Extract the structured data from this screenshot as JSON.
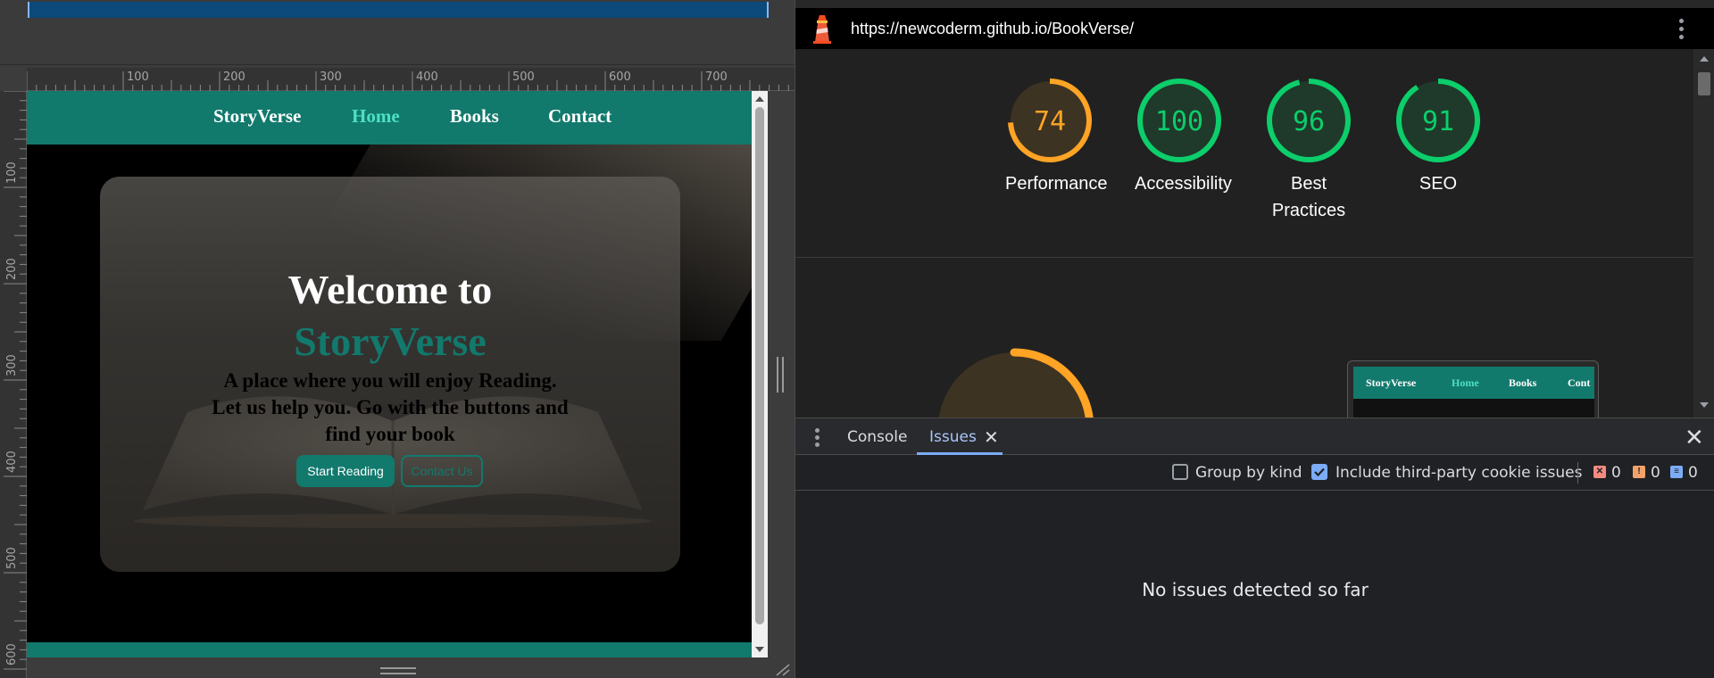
{
  "viewport_rulers": {
    "h_labels": [
      "100",
      "200",
      "300",
      "400",
      "500",
      "600",
      "700"
    ],
    "v_labels": [
      "100",
      "200",
      "300",
      "400",
      "500",
      "600"
    ]
  },
  "site": {
    "nav": {
      "brand": "StoryVerse",
      "links": [
        "Home",
        "Books",
        "Contact"
      ],
      "active_link": "Home"
    },
    "hero": {
      "title": "Welcome to",
      "brand": "StoryVerse",
      "subtitle": "A place where you will enjoy Reading. Let us help you. Go with the buttons and find your book",
      "primary_button": "Start Reading",
      "secondary_button": "Contact Us"
    },
    "colors": {
      "teal": "#12796d",
      "active_link": "#4de0c4"
    }
  },
  "devtools": {
    "url": "https://newcoderm.github.io/BookVerse/",
    "lighthouse": {
      "scores": [
        {
          "value": "74",
          "label": "Performance",
          "status": "average",
          "color": "#ffa425"
        },
        {
          "value": "100",
          "label": "Accessibility",
          "status": "pass",
          "color": "#0cce6b"
        },
        {
          "value": "96",
          "label": "Best Practices",
          "status": "pass",
          "color": "#0cce6b"
        },
        {
          "value": "91",
          "label": "SEO",
          "status": "pass",
          "color": "#0cce6b"
        }
      ],
      "main_score": "74",
      "thumbnail_nav": [
        "StoryVerse",
        "Home",
        "Books",
        "Cont"
      ]
    },
    "drawer": {
      "tabs": [
        "Console",
        "Issues"
      ],
      "active_tab": "Issues",
      "toolbar": {
        "group_by_kind": {
          "label": "Group by kind",
          "checked": false
        },
        "third_party": {
          "label": "Include third-party cookie issues",
          "checked": true
        },
        "counts": {
          "errors": "0",
          "warnings": "0",
          "info": "0"
        }
      },
      "empty_message": "No issues detected so far"
    }
  }
}
